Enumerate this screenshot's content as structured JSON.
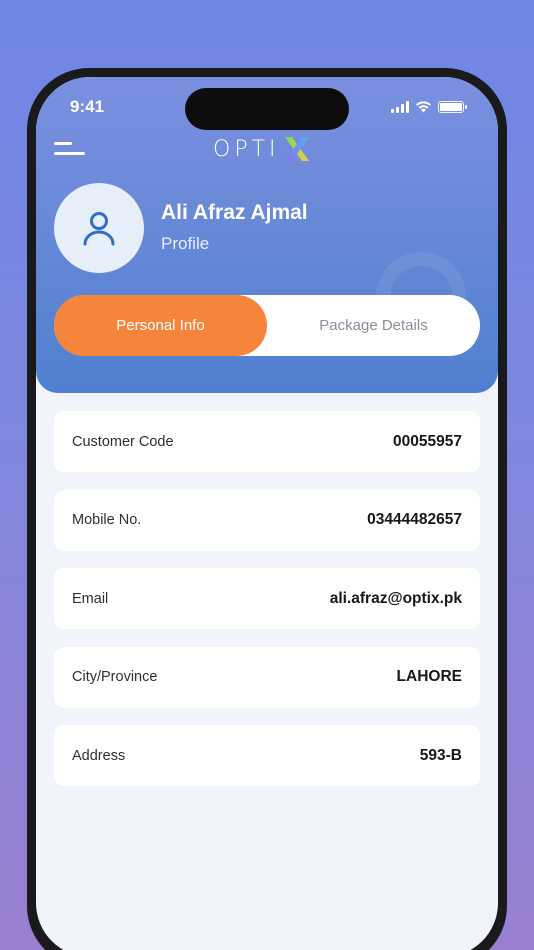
{
  "status_bar": {
    "time": "9:41"
  },
  "header": {
    "logo_text": "OPTI"
  },
  "profile": {
    "name": "Ali Afraz Ajmal",
    "subtitle": "Profile"
  },
  "tabs": [
    {
      "label": "Personal Info",
      "active": true
    },
    {
      "label": "Package Details",
      "active": false
    }
  ],
  "info_rows": [
    {
      "label": "Customer Code",
      "value": "00055957"
    },
    {
      "label": "Mobile No.",
      "value": "03444482657"
    },
    {
      "label": "Email",
      "value": "ali.afraz@optix.pk"
    },
    {
      "label": "City/Province",
      "value": "LAHORE"
    },
    {
      "label": "Address",
      "value": "593-B"
    }
  ],
  "colors": {
    "accent": "#f7843b",
    "header": "#5b84d3",
    "background": "#f1f4fb"
  }
}
